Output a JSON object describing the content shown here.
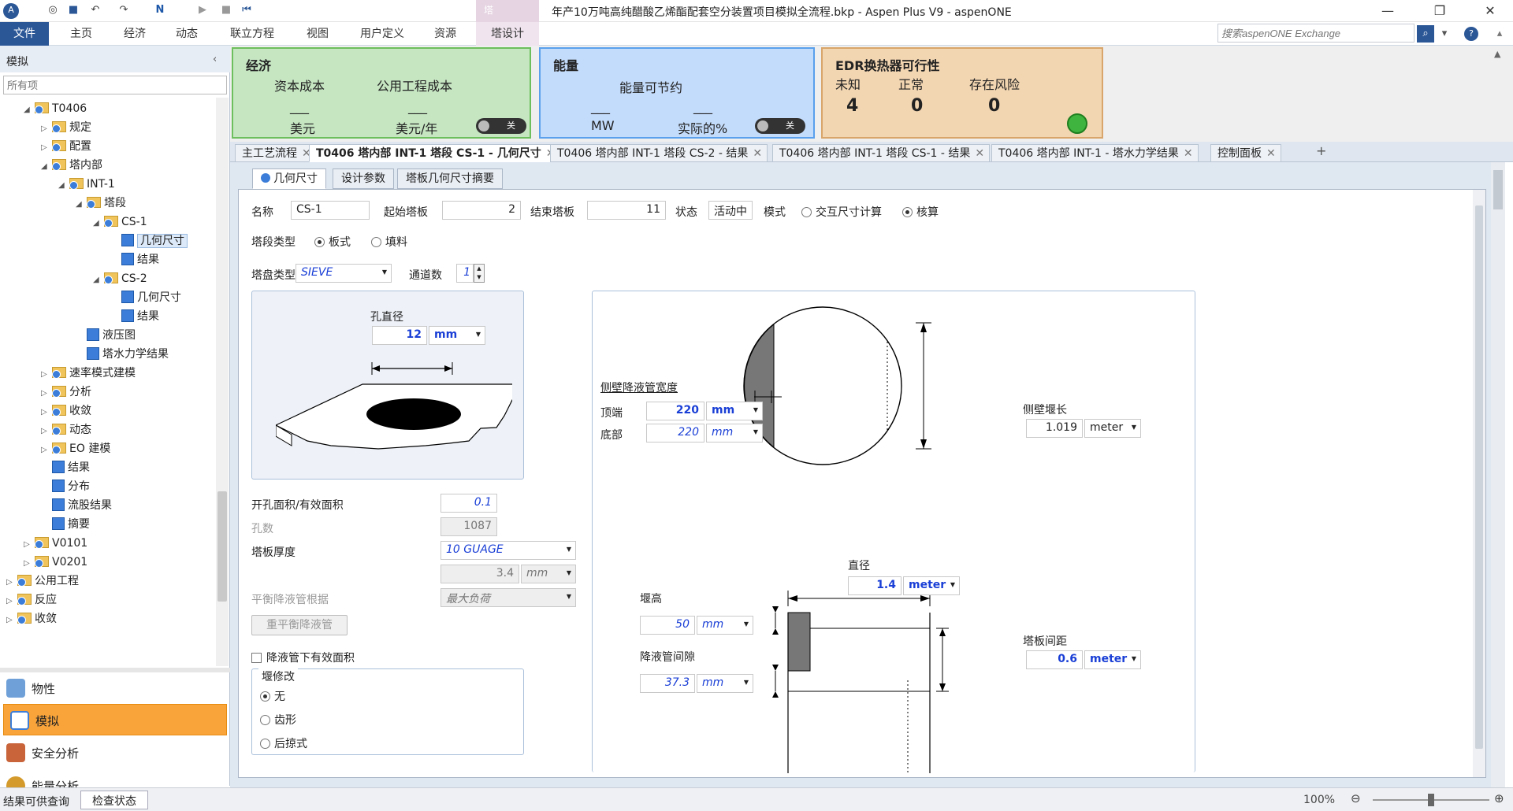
{
  "window": {
    "title": "年产10万吨高纯醋酸乙烯酯配套空分装置项目模拟全流程.bkp - Aspen Plus V9 - aspenONE",
    "context_tab": "塔"
  },
  "ribbon": {
    "tabs": [
      "文件",
      "主页",
      "经济",
      "动态",
      "联立方程",
      "视图",
      "用户定义",
      "资源",
      "塔设计"
    ],
    "search_placeholder": "搜索aspenONE Exchange"
  },
  "left": {
    "header": "模拟",
    "filter_placeholder": "所有项",
    "tree": [
      {
        "label": "T0406",
        "indent": 1,
        "tw": "◢"
      },
      {
        "label": "规定",
        "indent": 2,
        "tw": "▷"
      },
      {
        "label": "配置",
        "indent": 2,
        "tw": "▷"
      },
      {
        "label": "塔内部",
        "indent": 2,
        "tw": "◢"
      },
      {
        "label": "INT-1",
        "indent": 3,
        "tw": "◢"
      },
      {
        "label": "塔段",
        "indent": 4,
        "tw": "◢"
      },
      {
        "label": "CS-1",
        "indent": 5,
        "tw": "◢"
      },
      {
        "label": "几何尺寸",
        "indent": 6,
        "tw": "",
        "sel": true,
        "box": true
      },
      {
        "label": "结果",
        "indent": 6,
        "tw": "",
        "box": true
      },
      {
        "label": "CS-2",
        "indent": 5,
        "tw": "◢"
      },
      {
        "label": "几何尺寸",
        "indent": 6,
        "tw": "",
        "box": true
      },
      {
        "label": "结果",
        "indent": 6,
        "tw": "",
        "box": true
      },
      {
        "label": "液压图",
        "indent": 4,
        "tw": "",
        "box": true
      },
      {
        "label": "塔水力学结果",
        "indent": 4,
        "tw": "",
        "box": true
      },
      {
        "label": "速率模式建模",
        "indent": 2,
        "tw": "▷"
      },
      {
        "label": "分析",
        "indent": 2,
        "tw": "▷"
      },
      {
        "label": "收敛",
        "indent": 2,
        "tw": "▷"
      },
      {
        "label": "动态",
        "indent": 2,
        "tw": "▷"
      },
      {
        "label": "EO 建模",
        "indent": 2,
        "tw": "▷"
      },
      {
        "label": "结果",
        "indent": 2,
        "tw": "",
        "box": true
      },
      {
        "label": "分布",
        "indent": 2,
        "tw": "",
        "box": true
      },
      {
        "label": "流股结果",
        "indent": 2,
        "tw": "",
        "box": true
      },
      {
        "label": "摘要",
        "indent": 2,
        "tw": "",
        "box": true
      },
      {
        "label": "V0101",
        "indent": 1,
        "tw": "▷"
      },
      {
        "label": "V0201",
        "indent": 1,
        "tw": "▷"
      },
      {
        "label": "公用工程",
        "indent": 0,
        "tw": "▷"
      },
      {
        "label": "反应",
        "indent": 0,
        "tw": "▷"
      },
      {
        "label": "收敛",
        "indent": 0,
        "tw": "▷"
      }
    ],
    "nav": [
      "物性",
      "模拟",
      "安全分析",
      "能量分析"
    ]
  },
  "summary": {
    "econ": {
      "title": "经济",
      "capital": "资本成本",
      "utility": "公用工程成本",
      "dash": "___",
      "unit1": "美元",
      "unit2": "美元/年",
      "toggle": "关"
    },
    "energy": {
      "title": "能量",
      "saving": "能量可节约",
      "dash": "___",
      "unit1": "MW",
      "unit2": "实际的%",
      "toggle": "关"
    },
    "edr": {
      "title": "EDR换热器可行性",
      "unknown": "未知",
      "normal": "正常",
      "risk": "存在风险",
      "v1": "4",
      "v2": "0",
      "v3": "0"
    }
  },
  "doc_tabs": [
    {
      "label": "主工艺流程"
    },
    {
      "label": "T0406 塔内部 INT-1 塔段 CS-1 - 几何尺寸",
      "active": true
    },
    {
      "label": "T0406 塔内部 INT-1 塔段 CS-2 - 结果"
    },
    {
      "label": "T0406 塔内部 INT-1 塔段 CS-1 - 结果"
    },
    {
      "label": "T0406 塔内部 INT-1 - 塔水力学结果"
    },
    {
      "label": "控制面板"
    }
  ],
  "form": {
    "tabs": [
      "几何尺寸",
      "设计参数",
      "塔板几何尺寸摘要"
    ],
    "name_label": "名称",
    "name": "CS-1",
    "start_label": "起始塔板",
    "start": "2",
    "end_label": "结束塔板",
    "end": "11",
    "state_label": "状态",
    "state": "活动中",
    "mode_label": "模式",
    "mode_opt1": "交互尺寸计算",
    "mode_opt2": "核算",
    "section_type_label": "塔段类型",
    "sec_opt1": "板式",
    "sec_opt2": "填料",
    "tray_type_label": "塔盘类型",
    "tray_type": "SIEVE",
    "passes_label": "通道数",
    "passes": "1",
    "hole_dia_label": "孔直径",
    "hole_dia": "12",
    "hole_unit": "mm",
    "open_area_label": "开孔面积/有效面积",
    "open_area": "0.1",
    "holes_label": "孔数",
    "holes": "1087",
    "thick_label": "塔板厚度",
    "thick": "10 GUAGE",
    "thick_val": "3.4",
    "thick_unit": "mm",
    "balance_label": "平衡降液管根据",
    "balance": "最大负荷",
    "rebalance_btn": "重平衡降液管",
    "below_dc_label": "降液管下有效面积",
    "weir_mod_title": "堰修改",
    "weir_opts": [
      "无",
      "齿形",
      "后掠式"
    ],
    "side_dc_label": "侧壁降液管宽度",
    "top_label": "顶端",
    "top": "220",
    "top_unit": "mm",
    "bottom_label": "底部",
    "bottom": "220",
    "bottom_unit": "mm",
    "side_weir_label": "侧壁堰长",
    "side_weir": "1.019",
    "side_weir_unit": "meter",
    "dia_label": "直径",
    "dia": "1.4",
    "dia_unit": "meter",
    "weir_h_label": "堰高",
    "weir_h": "50",
    "weir_h_unit": "mm",
    "dc_clear_label": "降液管间隙",
    "dc_clear": "37.3",
    "dc_clear_unit": "mm",
    "spacing_label": "塔板间距",
    "spacing": "0.6",
    "spacing_unit": "meter"
  },
  "status": {
    "left1": "结果可供查询",
    "left2": "检查状态",
    "zoom": "100%"
  }
}
